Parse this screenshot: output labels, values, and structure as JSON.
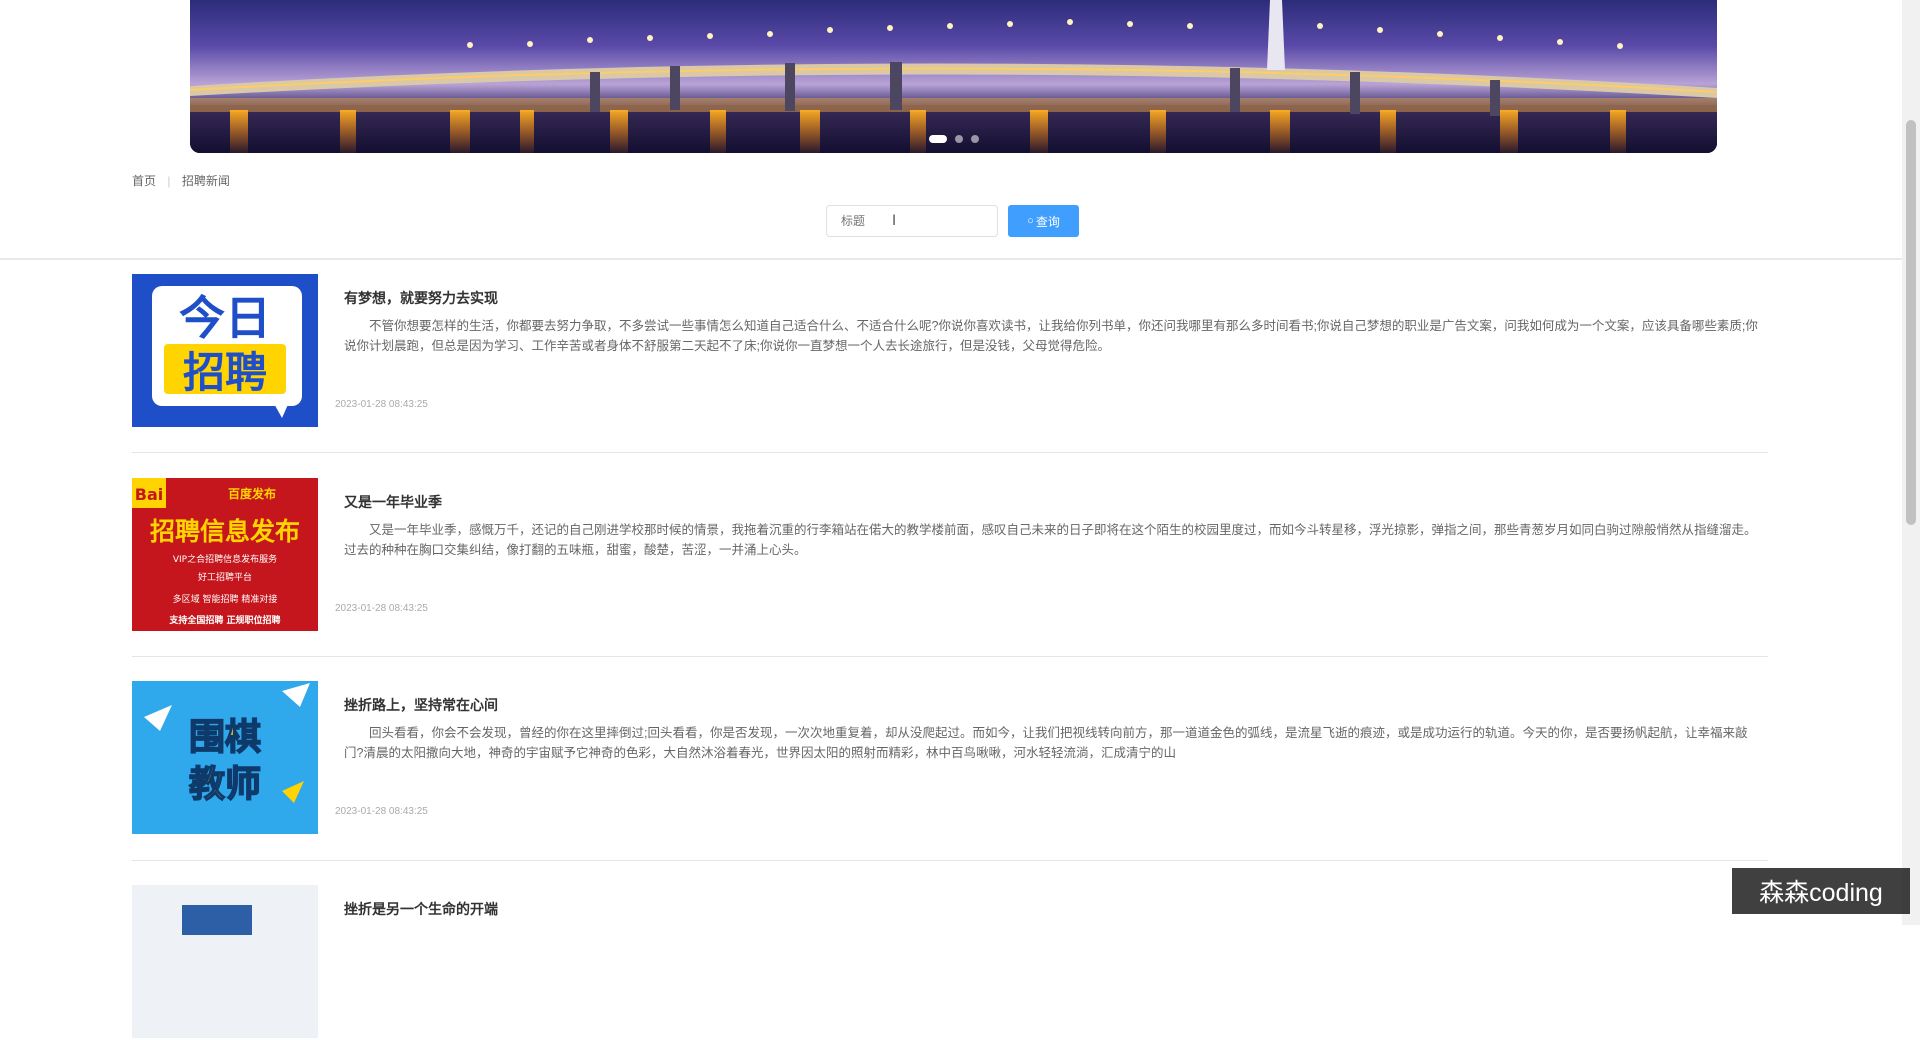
{
  "banner": {
    "slides": 3,
    "active_slide": 1
  },
  "breadcrumb": {
    "home": "首页",
    "current": "招聘新闻"
  },
  "search": {
    "placeholder": "标题",
    "button_label": "查询",
    "button_icon": "search-icon"
  },
  "colors": {
    "primary": "#409eff"
  },
  "news": [
    {
      "title": "有梦想，就要努力去实现",
      "body": "不管你想要怎样的生活，你都要去努力争取，不多尝试一些事情怎么知道自己适合什么、不适合什么呢?你说你喜欢读书，让我给你列书单，你还问我哪里有那么多时间看书;你说自己梦想的职业是广告文案，问我如何成为一个文案，应该具备哪些素质;你说你计划晨跑，但总是因为学习、工作辛苦或者身体不舒服第二天起不了床;你说你一直梦想一个人去长途旅行，但是没钱，父母觉得危险。",
      "date": "2023-01-28 08:43:25",
      "image": {
        "line1": "今日",
        "line2": "招聘"
      }
    },
    {
      "title": "又是一年毕业季",
      "body": "又是一年毕业季，感慨万千，还记的自己刚进学校那时候的情景，我拖着沉重的行李箱站在偌大的教学楼前面，感叹自己未来的日子即将在这个陌生的校园里度过，而如今斗转星移，浮光掠影，弹指之间，那些青葱岁月如同白驹过隙般悄然从指缝溜走。过去的种种在胸口交集纠结，像打翻的五味瓶，甜蜜，酸楚，苦涩，一并涌上心头。",
      "date": "2023-01-28 08:43:25",
      "image": {
        "badge": "Bai",
        "tag": "百度发布",
        "line1": "招聘信息发布",
        "line2": "VIP之合招聘信息发布服务",
        "line3": "好工招聘平台",
        "line4": "多区域  智能招聘  精准对接",
        "line5": "支持全国招聘  正规职位招聘"
      }
    },
    {
      "title": "挫折路上，坚持常在心间",
      "body": "回头看看，你会不会发现，曾经的你在这里摔倒过;回头看看，你是否发现，一次次地重复着，却从没爬起过。而如今，让我们把视线转向前方，那一道道金色的弧线，是流星飞逝的痕迹，或是成功运行的轨道。今天的你，是否要扬帆起航，让幸福来敲门?清晨的太阳撒向大地，神奇的宇宙赋予它神奇的色彩，大自然沐浴着春光，世界因太阳的照射而精彩，林中百鸟啾啾，河水轻轻流淌，汇成清宁的山",
      "date": "2023-01-28 08:43:25",
      "image": {
        "line1": "围棋",
        "line2": "教师"
      }
    },
    {
      "title": "挫折是另一个生命的开端",
      "body": "",
      "date": "",
      "image": {
        "line1": ""
      }
    }
  ],
  "watermark": "森森coding"
}
